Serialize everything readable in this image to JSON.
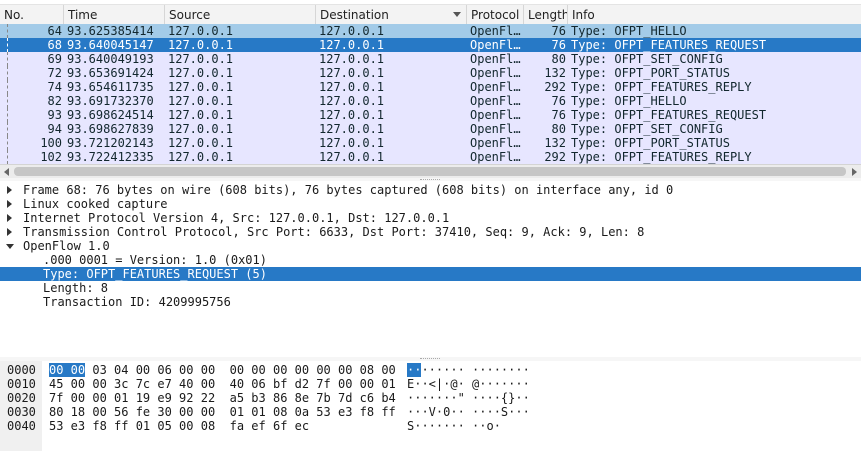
{
  "columns": [
    "No.",
    "Time",
    "Source",
    "Destination",
    "Protocol",
    "Length",
    "Info"
  ],
  "packets": [
    {
      "no": "64",
      "time": "93.625385414",
      "source": "127.0.0.1",
      "destination": "127.0.0.1",
      "protocol": "OpenFl…",
      "length": "76",
      "info": "Type: OFPT_HELLO",
      "state": "hl"
    },
    {
      "no": "68",
      "time": "93.640045147",
      "source": "127.0.0.1",
      "destination": "127.0.0.1",
      "protocol": "OpenFl…",
      "length": "76",
      "info": "Type: OFPT_FEATURES_REQUEST",
      "state": "sel"
    },
    {
      "no": "69",
      "time": "93.640049193",
      "source": "127.0.0.1",
      "destination": "127.0.0.1",
      "protocol": "OpenFl…",
      "length": "80",
      "info": "Type: OFPT_SET_CONFIG",
      "state": ""
    },
    {
      "no": "72",
      "time": "93.653691424",
      "source": "127.0.0.1",
      "destination": "127.0.0.1",
      "protocol": "OpenFl…",
      "length": "132",
      "info": "Type: OFPT_PORT_STATUS",
      "state": ""
    },
    {
      "no": "74",
      "time": "93.654611735",
      "source": "127.0.0.1",
      "destination": "127.0.0.1",
      "protocol": "OpenFl…",
      "length": "292",
      "info": "Type: OFPT_FEATURES_REPLY",
      "state": ""
    },
    {
      "no": "82",
      "time": "93.691732370",
      "source": "127.0.0.1",
      "destination": "127.0.0.1",
      "protocol": "OpenFl…",
      "length": "76",
      "info": "Type: OFPT_HELLO",
      "state": ""
    },
    {
      "no": "93",
      "time": "93.698624514",
      "source": "127.0.0.1",
      "destination": "127.0.0.1",
      "protocol": "OpenFl…",
      "length": "76",
      "info": "Type: OFPT_FEATURES_REQUEST",
      "state": ""
    },
    {
      "no": "94",
      "time": "93.698627839",
      "source": "127.0.0.1",
      "destination": "127.0.0.1",
      "protocol": "OpenFl…",
      "length": "80",
      "info": "Type: OFPT_SET_CONFIG",
      "state": ""
    },
    {
      "no": "100",
      "time": "93.721202143",
      "source": "127.0.0.1",
      "destination": "127.0.0.1",
      "protocol": "OpenFl…",
      "length": "132",
      "info": "Type: OFPT_PORT_STATUS",
      "state": ""
    },
    {
      "no": "102",
      "time": "93.722412335",
      "source": "127.0.0.1",
      "destination": "127.0.0.1",
      "protocol": "OpenFl…",
      "length": "292",
      "info": "Type: OFPT_FEATURES_REPLY",
      "state": ""
    }
  ],
  "details": [
    {
      "text": "Frame 68: 76 bytes on wire (608 bits), 76 bytes captured (608 bits) on interface any, id 0",
      "expander": "collapsed",
      "level": 0
    },
    {
      "text": "Linux cooked capture",
      "expander": "collapsed",
      "level": 0
    },
    {
      "text": "Internet Protocol Version 4, Src: 127.0.0.1, Dst: 127.0.0.1",
      "expander": "collapsed",
      "level": 0
    },
    {
      "text": "Transmission Control Protocol, Src Port: 6633, Dst Port: 37410, Seq: 9, Ack: 9, Len: 8",
      "expander": "collapsed",
      "level": 0
    },
    {
      "text": "OpenFlow 1.0",
      "expander": "expanded",
      "level": 0
    },
    {
      "text": ".000 0001 = Version: 1.0 (0x01)",
      "expander": "none",
      "level": 1
    },
    {
      "text": "Type: OFPT_FEATURES_REQUEST (5)",
      "expander": "none",
      "level": 1,
      "selected": true
    },
    {
      "text": "Length: 8",
      "expander": "none",
      "level": 1
    },
    {
      "text": "Transaction ID: 4209995756",
      "expander": "none",
      "level": 1
    }
  ],
  "bytes": [
    {
      "offset": "0000",
      "hex_hl": "00 00",
      "hex": " 03 04 00 06 00 00  00 00 00 00 00 00 08 00",
      "ascii_hl": "··",
      "ascii": "······ ········"
    },
    {
      "offset": "0010",
      "hex_hl": "",
      "hex": "45 00 00 3c 7c e7 40 00  40 06 bf d2 7f 00 00 01",
      "ascii_hl": "",
      "ascii": "E··<|·@· @·······"
    },
    {
      "offset": "0020",
      "hex_hl": "",
      "hex": "7f 00 00 01 19 e9 92 22  a5 b3 86 8e 7b 7d c6 b4",
      "ascii_hl": "",
      "ascii": "·······\" ····{}··"
    },
    {
      "offset": "0030",
      "hex_hl": "",
      "hex": "80 18 00 56 fe 30 00 00  01 01 08 0a 53 e3 f8 ff",
      "ascii_hl": "",
      "ascii": "···V·0·· ····S···"
    },
    {
      "offset": "0040",
      "hex_hl": "",
      "hex": "53 e3 f8 ff 01 05 00 08  fa ef 6f ec",
      "ascii_hl": "",
      "ascii": "S······· ··o·"
    }
  ],
  "colors": {
    "selected": "#2779c6",
    "row_bg": "#e7e6ff",
    "row_marked": "#a3cbe8"
  }
}
